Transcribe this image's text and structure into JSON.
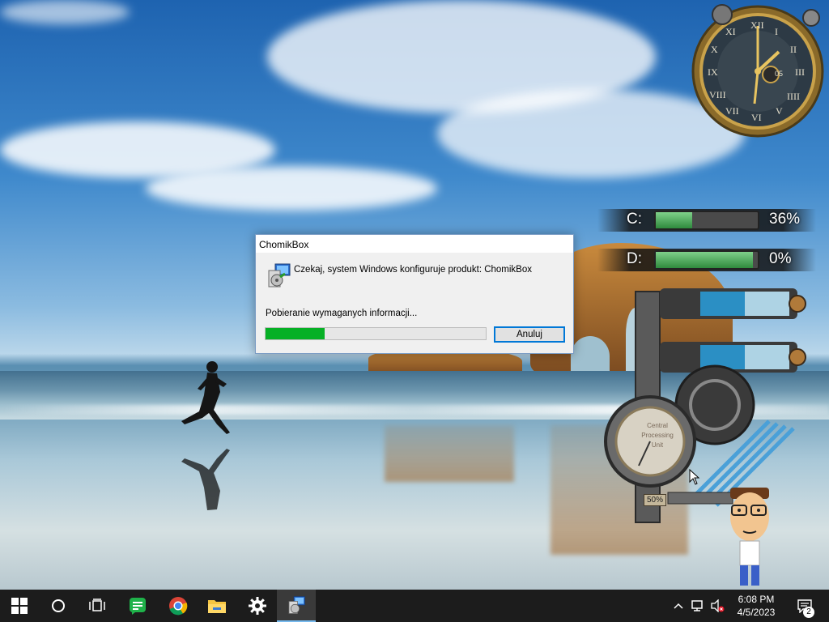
{
  "dialog": {
    "title": "ChomikBox",
    "message": "Czekaj, system Windows konfiguruje produkt: ChomikBox",
    "status": "Pobieranie wymaganych informacji...",
    "progress_fraction": 0.27,
    "cancel_label": "Anuluj"
  },
  "widgets": {
    "clock": {
      "numerals": [
        "XII",
        "I",
        "II",
        "III",
        "IIII",
        "V",
        "VI",
        "VII",
        "VIII",
        "IX",
        "X",
        "XI"
      ],
      "seconds_readout": "05"
    },
    "drives": [
      {
        "label": "C:",
        "percent_text": "36%",
        "fraction": 0.36
      },
      {
        "label": "D:",
        "percent_text": "0%",
        "fraction": 0.95
      }
    ],
    "gauge_label": "50%",
    "gauge_face_text": [
      "Central",
      "Processing",
      "Unit"
    ]
  },
  "taskbar": {
    "apps": [
      {
        "name": "start",
        "icon": "windows-logo-icon"
      },
      {
        "name": "search",
        "icon": "cortana-circle-icon"
      },
      {
        "name": "task-view",
        "icon": "task-view-icon"
      },
      {
        "name": "app-green",
        "icon": "chat-bubble-icon"
      },
      {
        "name": "chrome",
        "icon": "chrome-icon"
      },
      {
        "name": "file-explorer",
        "icon": "folder-icon"
      },
      {
        "name": "settings",
        "icon": "gear-icon"
      },
      {
        "name": "installer",
        "icon": "installer-icon"
      }
    ],
    "time": "6:08 PM",
    "date": "4/5/2023",
    "notification_count": "2"
  }
}
